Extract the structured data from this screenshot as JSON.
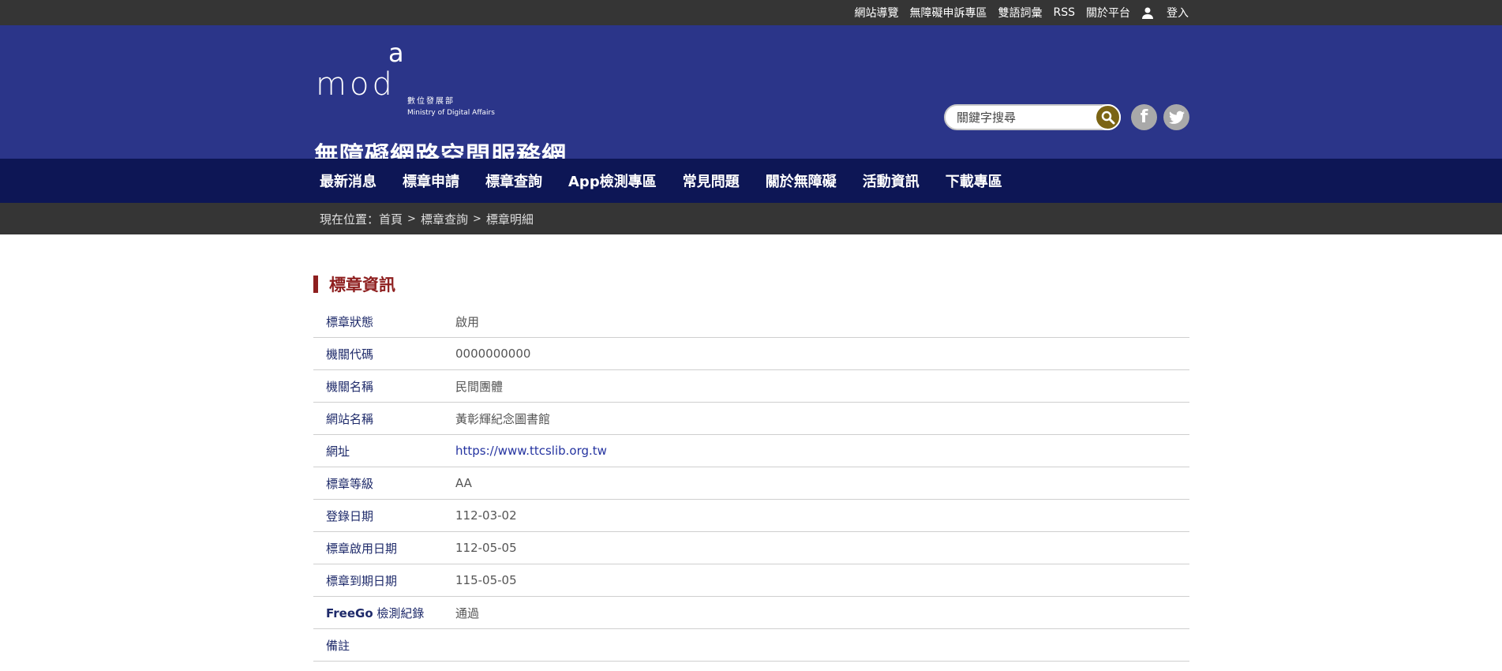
{
  "topbar": {
    "links": [
      "網站導覽",
      "無障礙申訴專區",
      "雙語詞彙",
      "RSS",
      "關於平台"
    ],
    "login": "登入"
  },
  "header": {
    "logo_text": "mod",
    "logo_a": "a",
    "logo_zh": "數位發展部",
    "logo_en": "Ministry of Digital Affairs",
    "site_title": "無障礙網路空間服務網",
    "search_placeholder": "關鍵字搜尋",
    "social": {
      "facebook": "f",
      "twitter_icon": "twitter-icon"
    }
  },
  "nav": {
    "items": [
      "最新消息",
      "標章申請",
      "標章查詢",
      "App檢測專區",
      "常見問題",
      "關於無障礙",
      "活動資訊",
      "下載專區"
    ]
  },
  "breadcrumb": {
    "prefix": "現在位置：",
    "items": [
      "首頁",
      "標章查詢",
      "標章明細"
    ],
    "sep": ">"
  },
  "section": {
    "title": "標章資訊"
  },
  "info": {
    "rows": [
      {
        "label": "標章狀態",
        "value": "啟用"
      },
      {
        "label": "機關代碼",
        "value": "0000000000"
      },
      {
        "label": "機關名稱",
        "value": "民間團體"
      },
      {
        "label": "網站名稱",
        "value": "黃彰輝紀念圖書館"
      },
      {
        "label": "網址",
        "value": "https://www.ttcslib.org.tw"
      },
      {
        "label": "標章等級",
        "value": "AA"
      },
      {
        "label": "登錄日期",
        "value": "112-03-02"
      },
      {
        "label": "標章啟用日期",
        "value": "112-05-05"
      },
      {
        "label": "標章到期日期",
        "value": "115-05-05"
      },
      {
        "label_bold": "FreeGo",
        "label": " 檢測紀錄",
        "value": "通過"
      },
      {
        "label": "備註",
        "value": ""
      }
    ]
  }
}
